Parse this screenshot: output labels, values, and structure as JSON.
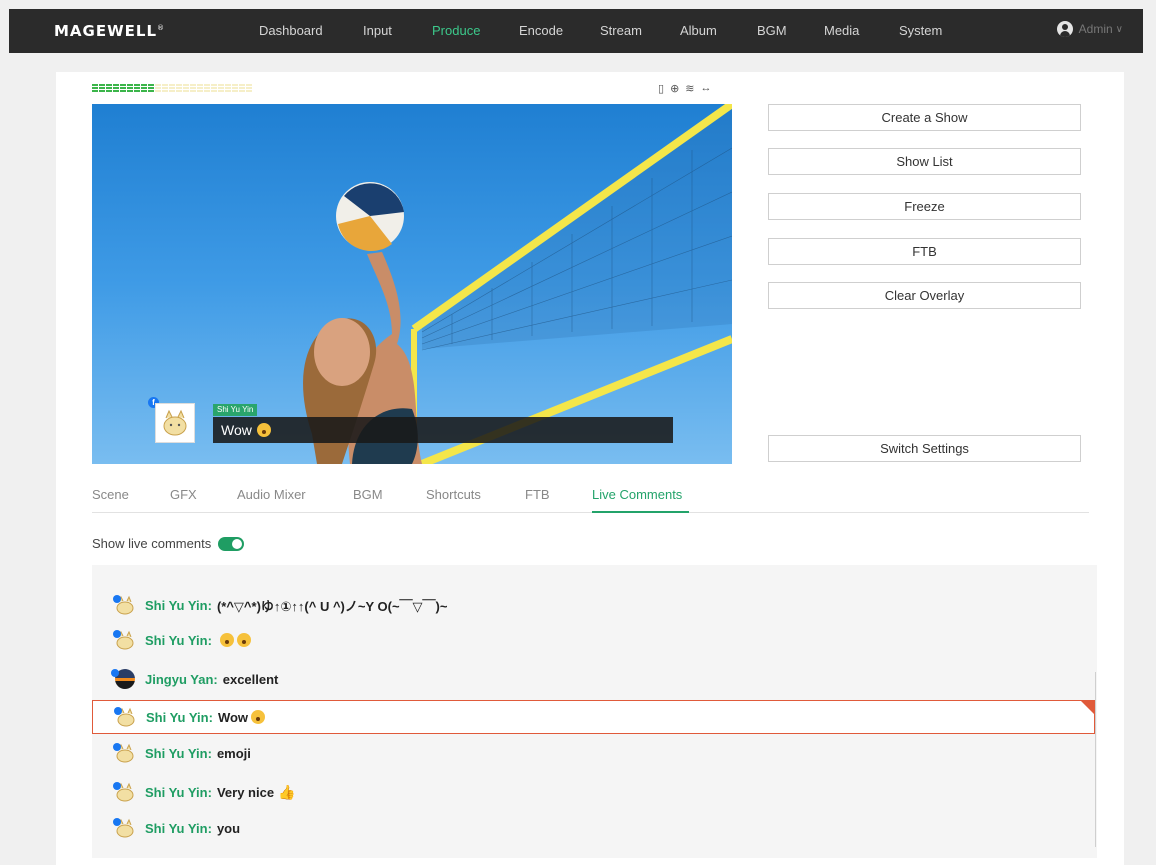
{
  "header": {
    "logo": "MAGEWELL",
    "logo_mark": "®",
    "nav": [
      "Dashboard",
      "Input",
      "Produce",
      "Encode",
      "Stream",
      "Album",
      "BGM",
      "Media",
      "System"
    ],
    "active_nav": "Produce",
    "user": "Admin"
  },
  "preview": {
    "overlay_name": "Shi Yu Yin",
    "overlay_text": "Wow",
    "overlay_platform": "f"
  },
  "side_buttons": [
    "Create a Show",
    "Show List",
    "Freeze",
    "FTB",
    "Clear Overlay"
  ],
  "switch_settings": "Switch Settings",
  "tabs": [
    "Scene",
    "GFX",
    "Audio Mixer",
    "BGM",
    "Shortcuts",
    "FTB",
    "Live Comments"
  ],
  "active_tab": "Live Comments",
  "live_comments": {
    "toggle_label": "Show live comments",
    "toggle_on": true,
    "items": [
      {
        "name": "Shi Yu Yin:",
        "text": "(*^▽^*)ゆ↑①↑↑(^ U ^)ノ~Y O(~￣▽￣)~",
        "emojis": 0,
        "thumb": false,
        "avatar": "cat-avatar"
      },
      {
        "name": "Shi Yu Yin:",
        "text": "",
        "emojis": 2,
        "thumb": false,
        "avatar": "cat-avatar"
      },
      {
        "name": "Jingyu Yan:",
        "text": "excellent",
        "emojis": 0,
        "thumb": false,
        "avatar": "round-avatar"
      },
      {
        "name": "Shi Yu Yin:",
        "text": "Wow",
        "emojis": 1,
        "thumb": false,
        "avatar": "cat-avatar",
        "selected": true
      },
      {
        "name": "Shi Yu Yin:",
        "text": "emoji",
        "emojis": 0,
        "thumb": false,
        "avatar": "cat-avatar"
      },
      {
        "name": "Shi Yu Yin:",
        "text": "Very nice",
        "emojis": 0,
        "thumb": true,
        "avatar": "cat-avatar"
      },
      {
        "name": "Shi Yu Yin:",
        "text": "you",
        "emojis": 0,
        "thumb": false,
        "avatar": "cat-avatar"
      }
    ]
  },
  "audio_meter": {
    "level": 0.4
  },
  "colors": {
    "accent": "#23a36a",
    "nav_bg": "#2b2b2b",
    "selected_border": "#e05a3a"
  }
}
